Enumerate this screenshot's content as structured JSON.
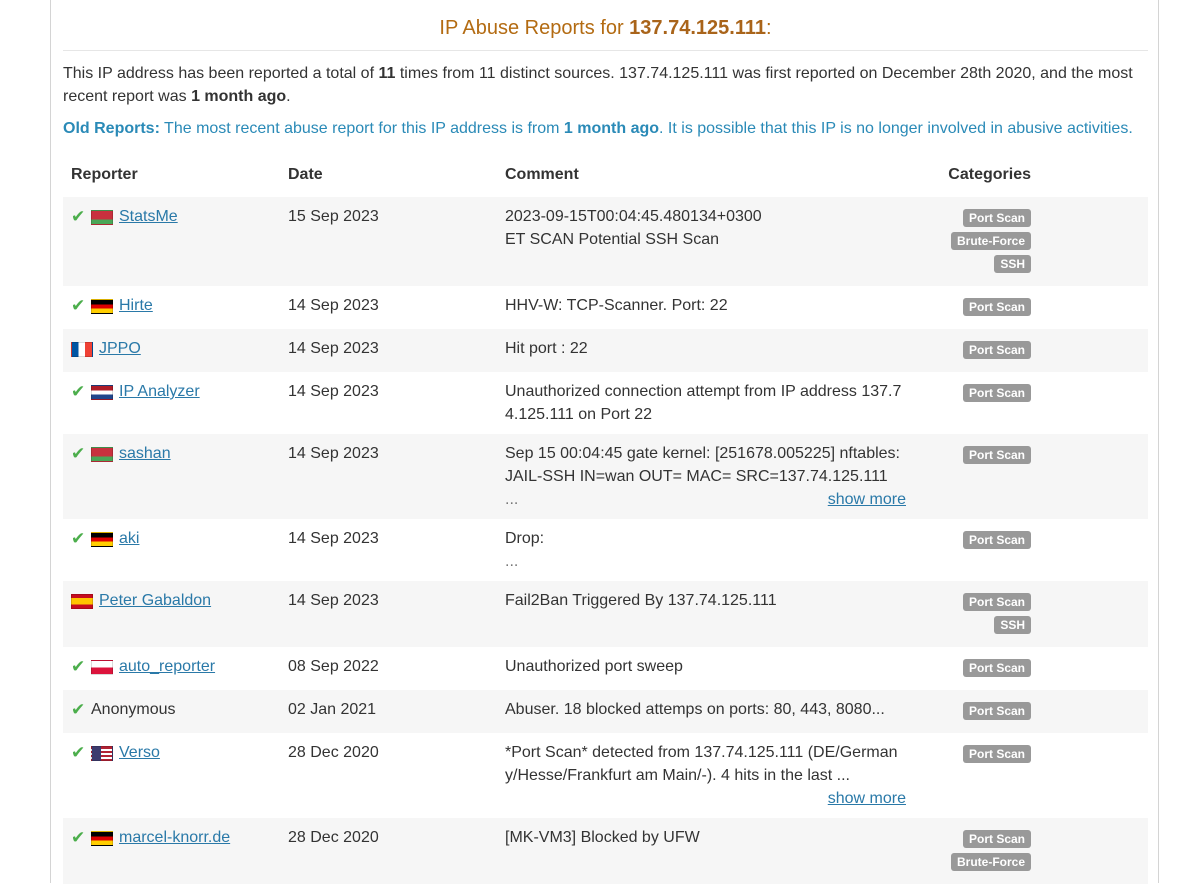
{
  "header": {
    "title_prefix": "IP Abuse Reports for ",
    "ip": "137.74.125.111",
    "title_suffix": ":"
  },
  "summary": {
    "t1": "This IP address has been reported a total of ",
    "count": "11",
    "t2": " times from 11 distinct sources. 137.74.125.111 was first reported on December 28th 2020, and the most recent report was ",
    "recent": "1 month ago",
    "t3": "."
  },
  "old_reports": {
    "label": "Old Reports:",
    "t1": " The most recent abuse report for this IP address is from ",
    "recent": "1 month ago",
    "t2": ". It is possible that this IP is no longer involved in abusive activities."
  },
  "table": {
    "headers": {
      "reporter": "Reporter",
      "date": "Date",
      "comment": "Comment",
      "categories": "Categories"
    },
    "rows": [
      {
        "verified": true,
        "flag": "by",
        "reporter": "StatsMe",
        "date": "15 Sep 2023",
        "comment_lines": [
          "2023-09-15T00:04:45.480134+0300",
          "ET SCAN Potential SSH Scan"
        ],
        "more": "",
        "categories": [
          "Port Scan",
          "Brute-Force",
          "SSH"
        ]
      },
      {
        "verified": true,
        "flag": "de",
        "reporter": "Hirte",
        "date": "14 Sep 2023",
        "comment_lines": [
          "HHV-W: TCP-Scanner. Port: 22"
        ],
        "more": "",
        "categories": [
          "Port Scan"
        ]
      },
      {
        "verified": false,
        "flag": "fr",
        "reporter": "JPPO",
        "date": "14 Sep 2023",
        "comment_lines": [
          "Hit port : 22"
        ],
        "more": "",
        "categories": [
          "Port Scan"
        ]
      },
      {
        "verified": true,
        "flag": "nl",
        "reporter": "IP Analyzer",
        "date": "14 Sep 2023",
        "comment_lines": [
          "Unauthorized connection attempt from IP address 137.7",
          "4.125.111 on Port 22"
        ],
        "more": "",
        "categories": [
          "Port Scan"
        ]
      },
      {
        "verified": true,
        "flag": "by",
        "reporter": "sashan",
        "date": "14 Sep 2023",
        "comment_lines": [
          "Sep 15 00:04:45 gate kernel: [251678.005225] nftables:",
          "JAIL-SSH IN=wan OUT= MAC= SRC=137.74.125.111",
          "..."
        ],
        "more": "show more",
        "categories": [
          "Port Scan"
        ]
      },
      {
        "verified": true,
        "flag": "de",
        "reporter": "aki",
        "date": "14 Sep 2023",
        "comment_lines": [
          "Drop:",
          "..."
        ],
        "more": "",
        "categories": [
          "Port Scan"
        ]
      },
      {
        "verified": false,
        "flag": "es",
        "reporter": "Peter Gabaldon",
        "date": "14 Sep 2023",
        "comment_lines": [
          "Fail2Ban Triggered By 137.74.125.111"
        ],
        "more": "",
        "categories": [
          "Port Scan",
          "SSH"
        ]
      },
      {
        "verified": true,
        "flag": "pl",
        "reporter": "auto_reporter",
        "date": "08 Sep 2022",
        "comment_lines": [
          "Unauthorized port sweep"
        ],
        "more": "",
        "categories": [
          "Port Scan"
        ]
      },
      {
        "verified": true,
        "flag": "",
        "reporter": "Anonymous",
        "date": "02 Jan 2021",
        "comment_lines": [
          "Abuser. 18 blocked attemps on ports: 80, 443, 8080..."
        ],
        "more": "",
        "categories": [
          "Port Scan"
        ]
      },
      {
        "verified": true,
        "flag": "us",
        "reporter": "Verso",
        "date": "28 Dec 2020",
        "comment_lines": [
          "*Port Scan* detected from 137.74.125.111 (DE/German",
          "y/Hesse/Frankfurt am Main/-). 4 hits in the last ..."
        ],
        "more": "show more",
        "categories": [
          "Port Scan"
        ]
      },
      {
        "verified": true,
        "flag": "de",
        "reporter": "marcel-knorr.de",
        "date": "28 Dec 2020",
        "comment_lines": [
          "[MK-VM3] Blocked by UFW"
        ],
        "more": "",
        "categories": [
          "Port Scan",
          "Brute-Force"
        ]
      }
    ]
  },
  "colors": {
    "title": "#b36b12",
    "notice": "#2a8ab7",
    "link": "#2a79a8",
    "check": "#4cae4c",
    "badge": "#999999",
    "row_alt": "#f6f6f6"
  }
}
